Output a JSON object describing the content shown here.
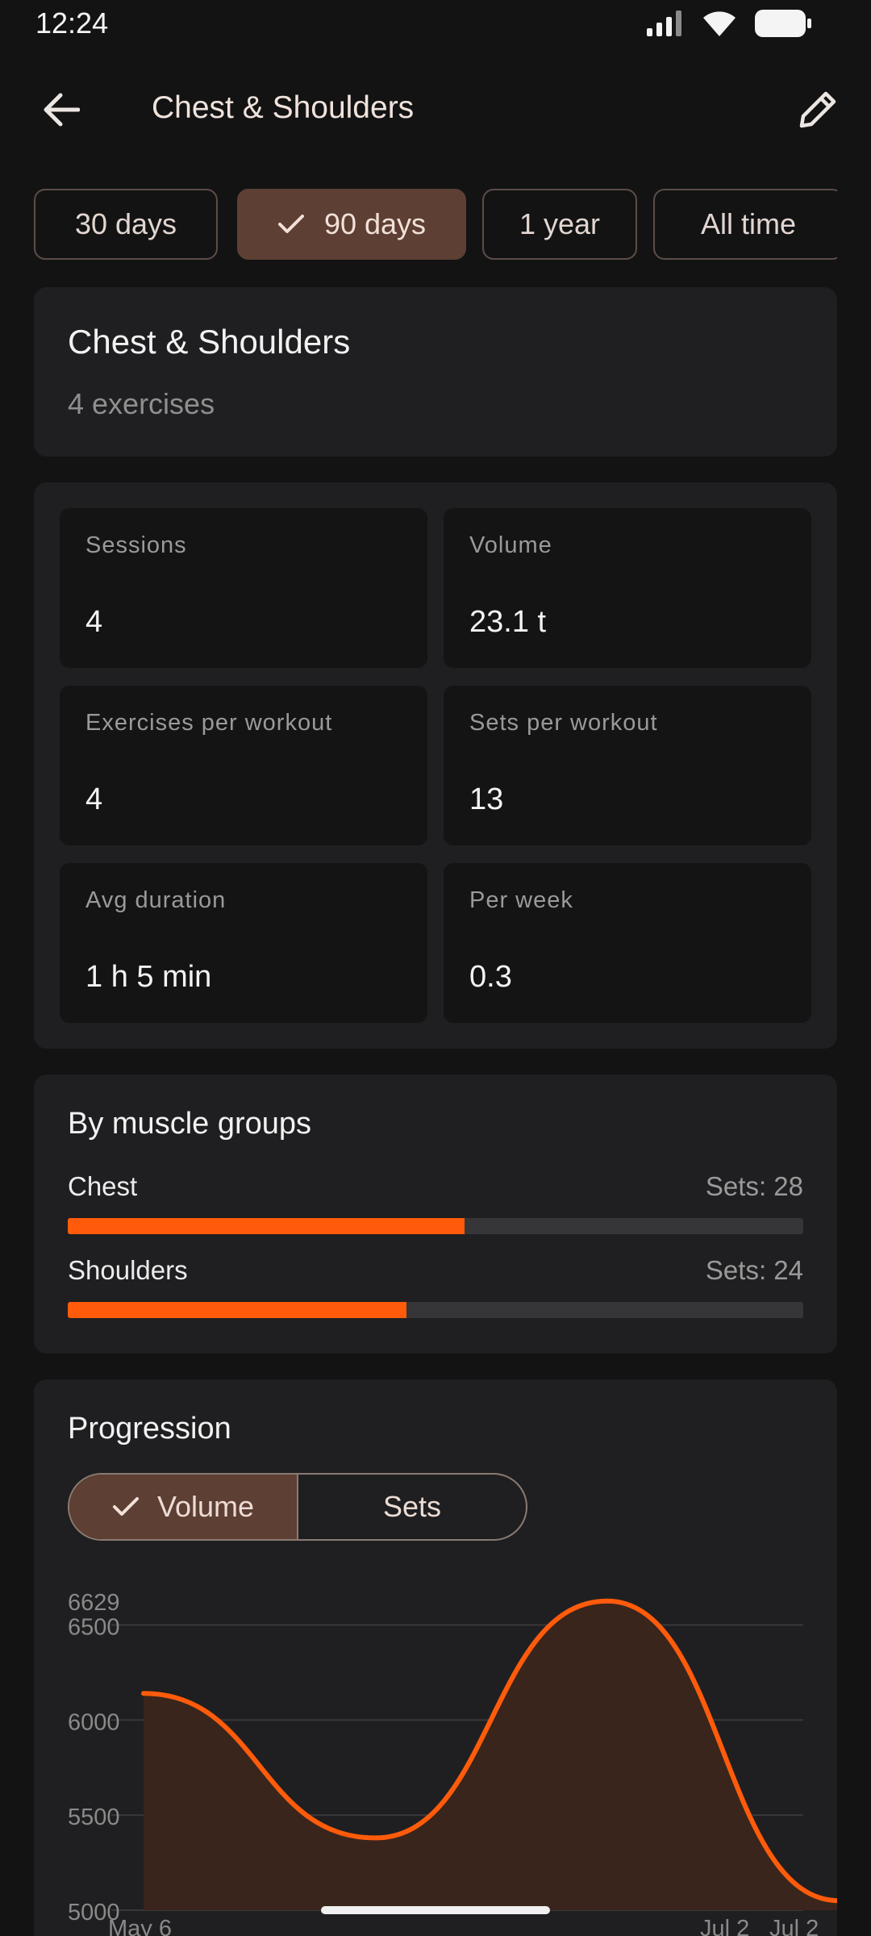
{
  "status": {
    "time": "12:24"
  },
  "app_bar": {
    "title": "Chest & Shoulders"
  },
  "filters": [
    {
      "label": "30 days",
      "selected": false
    },
    {
      "label": "90 days",
      "selected": true
    },
    {
      "label": "1 year",
      "selected": false
    },
    {
      "label": "All time",
      "selected": false
    }
  ],
  "header_card": {
    "title": "Chest & Shoulders",
    "subtitle": "4 exercises"
  },
  "stats": [
    {
      "label": "Sessions",
      "value": "4"
    },
    {
      "label": "Volume",
      "value": "23.1 t"
    },
    {
      "label": "Exercises per workout",
      "value": "4"
    },
    {
      "label": "Sets per workout",
      "value": "13"
    },
    {
      "label": "Avg duration",
      "value": "1 h 5 min"
    },
    {
      "label": "Per week",
      "value": "0.3"
    }
  ],
  "muscle_groups": {
    "title": "By muscle groups",
    "items": [
      {
        "name": "Chest",
        "sets_label": "Sets: 28",
        "fill_fraction": 0.54
      },
      {
        "name": "Shoulders",
        "sets_label": "Sets: 24",
        "fill_fraction": 0.46
      }
    ]
  },
  "progression": {
    "title": "Progression",
    "toggle": [
      {
        "label": "Volume",
        "selected": true
      },
      {
        "label": "Sets",
        "selected": false
      }
    ]
  },
  "colors": {
    "accent": "#ff5b0b",
    "selected_chip": "#5d3f34",
    "card": "#1f1f21",
    "background": "#131314"
  },
  "chart_data": {
    "type": "area",
    "title": "",
    "xlabel": "",
    "ylabel": "",
    "y_ticks": [
      5000,
      5500,
      6000,
      6500,
      6629
    ],
    "ylim": [
      5000,
      6629
    ],
    "x_tick_labels": [
      "May 6",
      "Jul 2",
      "Jul 2"
    ],
    "series": [
      {
        "values": [
          6140,
          5380,
          6626,
          5050
        ]
      }
    ],
    "grid": true
  }
}
